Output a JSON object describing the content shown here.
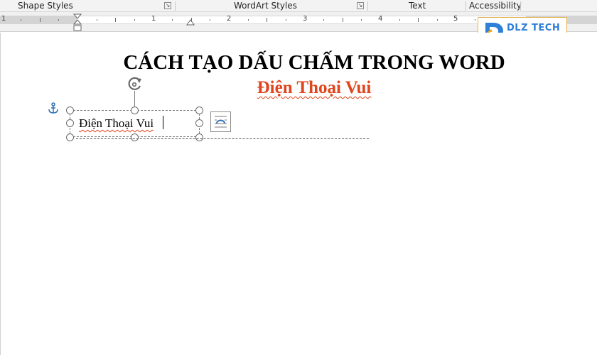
{
  "ribbon": {
    "groups": [
      {
        "label": "Shape Styles"
      },
      {
        "label": "WordArt Styles"
      },
      {
        "label": "Text"
      },
      {
        "label": "Accessibility"
      }
    ]
  },
  "ruler": {
    "numbers": [
      "1",
      "1",
      "2",
      "3",
      "4",
      "5"
    ]
  },
  "watermark": {
    "text": "DLZ TECH"
  },
  "document": {
    "title": "CÁCH TẠO DẤU CHẤM TRONG WORD",
    "subtitle": "Điện Thoại Vui",
    "textbox_text": "Điện Thoại Vui"
  },
  "colors": {
    "subtitle": "#e0451d",
    "logo": "#2e7fd8"
  },
  "icons": {
    "anchor": "anchor-icon",
    "rotate": "rotate-handle-icon",
    "layout_options": "layout-options-icon"
  }
}
